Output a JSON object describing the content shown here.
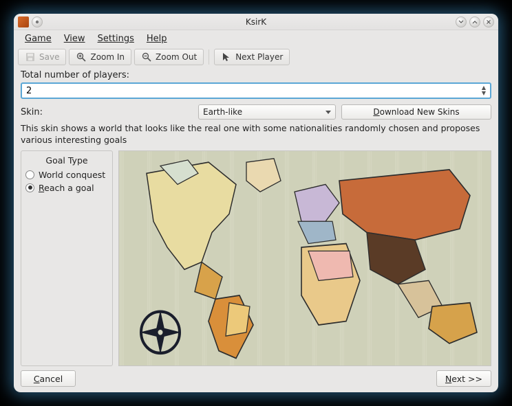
{
  "window": {
    "title": "KsirK"
  },
  "menus": {
    "game": "Game",
    "view": "View",
    "settings": "Settings",
    "help": "Help"
  },
  "toolbar": {
    "save": "Save",
    "zoom_in": "Zoom In",
    "zoom_out": "Zoom Out",
    "next_player": "Next Player"
  },
  "players": {
    "label": "Total number of players:",
    "value": "2"
  },
  "skin": {
    "label": "Skin:",
    "selected": "Earth-like",
    "download_prefix": "D",
    "download_rest": "ownload New Skins"
  },
  "description": "This skin shows a world that looks like the real one with some nationalities randomly chosen and proposes various interesting goals",
  "goal": {
    "title": "Goal Type",
    "opt_world": "World conquest",
    "opt_reach_u": "R",
    "opt_reach_rest": "each a goal"
  },
  "buttons": {
    "cancel_u": "C",
    "cancel_rest": "ancel",
    "next_u": "N",
    "next_rest": "ext >>"
  }
}
